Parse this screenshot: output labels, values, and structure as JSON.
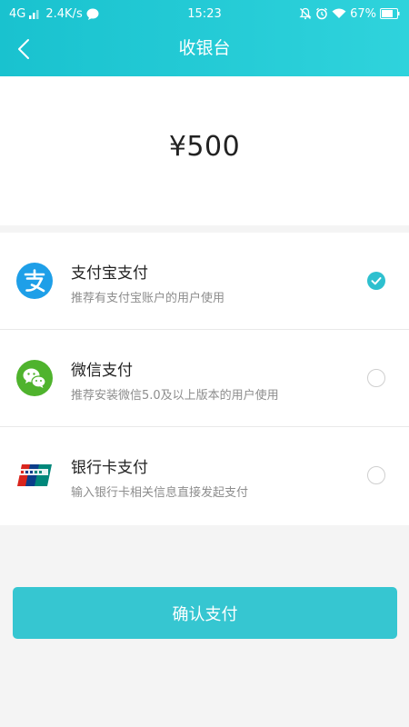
{
  "status_bar": {
    "network": "4G",
    "speed": "2.4K/s",
    "time": "15:23",
    "battery": "67%"
  },
  "nav": {
    "title": "收银台"
  },
  "amount": {
    "display": "¥500"
  },
  "payment_methods": [
    {
      "title": "支付宝支付",
      "subtitle": "推荐有支付宝账户的用户使用",
      "selected": true,
      "icon": "alipay-icon",
      "color": "#1e9fe8"
    },
    {
      "title": "微信支付",
      "subtitle": "推荐安装微信5.0及以上版本的用户使用",
      "selected": false,
      "icon": "wechat-icon",
      "color": "#4fb32d"
    },
    {
      "title": "银行卡支付",
      "subtitle": "输入银行卡相关信息直接发起支付",
      "selected": false,
      "icon": "unionpay-icon",
      "color": "#d9251d"
    }
  ],
  "confirm": {
    "label": "确认支付"
  },
  "colors": {
    "accent": "#36c6d1",
    "header_start": "#19c2cf",
    "header_end": "#2fd3dc"
  }
}
